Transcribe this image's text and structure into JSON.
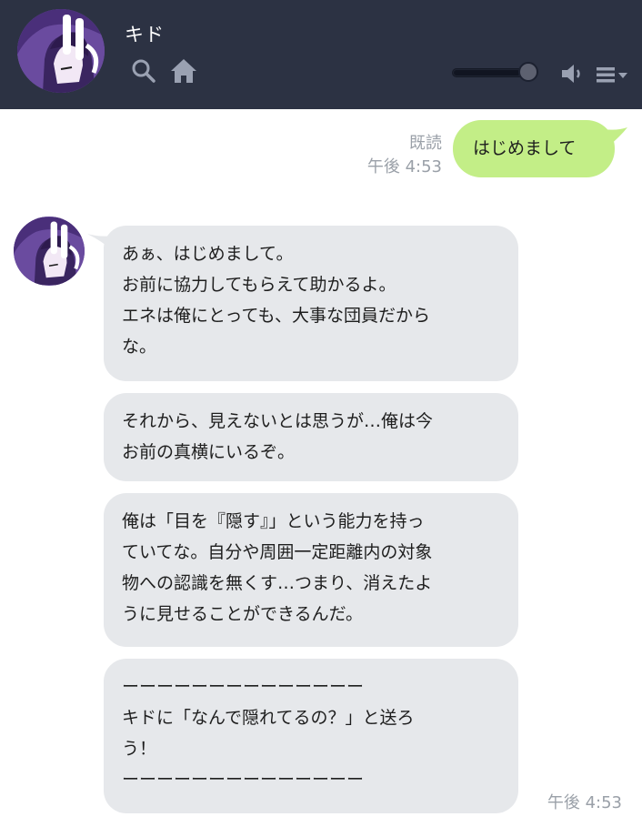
{
  "header": {
    "contact_name": "キド",
    "icons": [
      "search-icon",
      "home-icon",
      "volume-slider",
      "speaker-icon",
      "menu-icon"
    ],
    "volume_level": 0.9
  },
  "colors": {
    "header_bg": "#2c3243",
    "sent_bubble": "#c3ee87",
    "received_bubble": "#e6e8eb",
    "meta_text": "#9aa0a8",
    "avatar_purple": "#6b4ea6"
  },
  "messages": {
    "sent": {
      "read_label": "既読",
      "time": "午後 4:53",
      "text": "はじめまして"
    },
    "received": [
      {
        "lines": [
          "あぁ、はじめまして。",
          "お前に協力してもらえて助かるよ。",
          "エネは俺にとっても、大事な団員だから",
          "な。"
        ]
      },
      {
        "lines": [
          "それから、見えないとは思うが…俺は今",
          "お前の真横にいるぞ。"
        ]
      },
      {
        "lines": [
          "俺は「目を『隠す』」という能力を持っ",
          "ていてな。自分や周囲一定距離内の対象",
          "物への認識を無くす…つまり、消えたよ",
          "うに見せることができるんだ。"
        ]
      },
      {
        "lines": [
          "ーーーーーーーーーーーーーー",
          "キドに「なんで隠れてるの？」と送ろ",
          "う！",
          "ーーーーーーーーーーーーーー"
        ]
      }
    ],
    "received_time": "午後 4:53"
  }
}
